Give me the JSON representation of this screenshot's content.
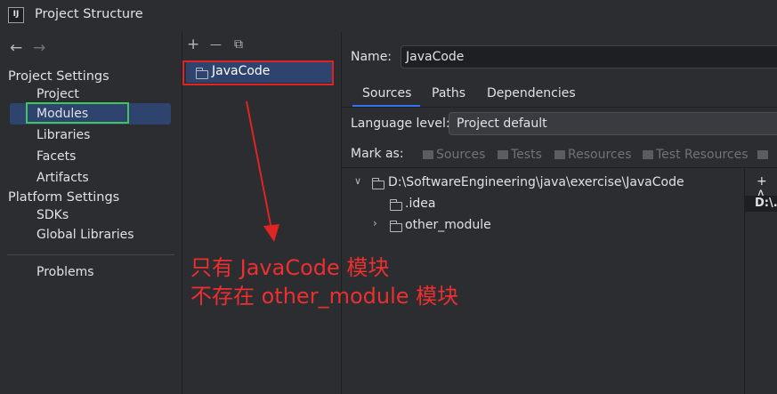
{
  "window": {
    "app_icon": "IJ",
    "title": "Project Structure"
  },
  "nav": {
    "back": "←",
    "forward": "→",
    "project_settings": "Project Settings",
    "items_project": [
      "Project",
      "Modules",
      "Libraries",
      "Facets",
      "Artifacts"
    ],
    "platform_settings": "Platform Settings",
    "items_platform": [
      "SDKs",
      "Global Libraries"
    ],
    "problems": "Problems",
    "selected": "Modules"
  },
  "modules_toolbar": {
    "add": "+",
    "remove": "—",
    "copy": "⧉"
  },
  "modules": [
    "JavaCode"
  ],
  "module_detail": {
    "name_label": "Name:",
    "name_value": "JavaCode",
    "tabs": [
      "Sources",
      "Paths",
      "Dependencies"
    ],
    "active_tab": "Sources",
    "language_level_label": "Language level:",
    "language_level_value": "Project default",
    "mark_as_label": "Mark as:",
    "mark_as_options": [
      "Sources",
      "Tests",
      "Resources",
      "Test Resources"
    ]
  },
  "tree": {
    "root": "D:\\SoftwareEngineering\\java\\exercise\\JavaCode",
    "children": [
      ".idea",
      "other_module"
    ]
  },
  "content_root": {
    "add": "+ A",
    "path": "D:\\..."
  },
  "annotation": {
    "line1": "只有 JavaCode 模块",
    "line2": "不存在 other_module 模块"
  },
  "colors": {
    "background": "#2b2d30",
    "selection": "#2e436e",
    "accent": "#3574f0",
    "annotation_red": "#e02424",
    "highlight_green": "#3fc558"
  }
}
